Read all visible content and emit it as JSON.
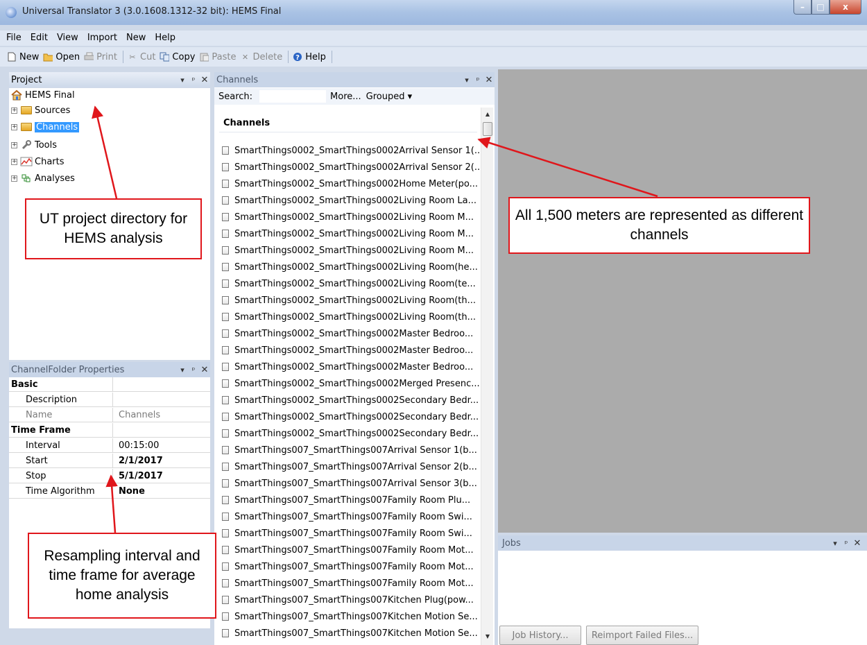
{
  "window": {
    "title": "Universal Translator 3 (3.0.1608.1312-32 bit): HEMS Final",
    "controls": {
      "minimize": "–",
      "maximize": "□",
      "close": "x"
    }
  },
  "menubar": [
    "File",
    "Edit",
    "View",
    "Import",
    "New",
    "Help"
  ],
  "toolbar": {
    "new": "New",
    "open": "Open",
    "print": "Print",
    "cut": "Cut",
    "copy": "Copy",
    "paste": "Paste",
    "delete": "Delete",
    "help": "Help"
  },
  "panel_controls": {
    "dropdown": "▾",
    "pin": "ᵖ",
    "close": "✕"
  },
  "project": {
    "header": "Project",
    "root": "HEMS Final",
    "expander": "+",
    "items": [
      {
        "label": "Sources",
        "icon": "folder-icon"
      },
      {
        "label": "Channels",
        "icon": "folder-icon",
        "selected": true
      },
      {
        "label": "Tools",
        "icon": "wrench-icon"
      },
      {
        "label": "Charts",
        "icon": "chart-icon"
      },
      {
        "label": "Analyses",
        "icon": "analysis-icon"
      }
    ]
  },
  "properties": {
    "header": "ChannelFolder Properties",
    "rows": [
      {
        "key": "Basic",
        "value": ""
      },
      {
        "key": "Description",
        "value": ""
      },
      {
        "key": "Name",
        "value": "Channels"
      },
      {
        "key": "Time Frame",
        "value": ""
      },
      {
        "key": "Interval",
        "value": "00:15:00"
      },
      {
        "key": "Start",
        "value": "2/1/2017"
      },
      {
        "key": "Stop",
        "value": "5/1/2017"
      },
      {
        "key": "Time Algorithm",
        "value": "None"
      }
    ]
  },
  "channels": {
    "header": "Channels",
    "search_label": "Search:",
    "search_value": "",
    "more": "More...",
    "grouped": "Grouped ▾",
    "group_title": "Channels",
    "items": [
      "SmartThings0002_SmartThings0002Arrival Sensor 1(...",
      "SmartThings0002_SmartThings0002Arrival Sensor 2(...",
      "SmartThings0002_SmartThings0002Home Meter(po...",
      "SmartThings0002_SmartThings0002Living Room La...",
      "SmartThings0002_SmartThings0002Living Room M...",
      "SmartThings0002_SmartThings0002Living Room M...",
      "SmartThings0002_SmartThings0002Living Room M...",
      "SmartThings0002_SmartThings0002Living Room(he...",
      "SmartThings0002_SmartThings0002Living Room(te...",
      "SmartThings0002_SmartThings0002Living Room(th...",
      "SmartThings0002_SmartThings0002Living Room(th...",
      "SmartThings0002_SmartThings0002Master Bedroo...",
      "SmartThings0002_SmartThings0002Master Bedroo...",
      "SmartThings0002_SmartThings0002Master Bedroo...",
      "SmartThings0002_SmartThings0002Merged Presenc...",
      "SmartThings0002_SmartThings0002Secondary Bedr...",
      "SmartThings0002_SmartThings0002Secondary Bedr...",
      "SmartThings0002_SmartThings0002Secondary Bedr...",
      "SmartThings007_SmartThings007Arrival Sensor 1(b...",
      "SmartThings007_SmartThings007Arrival Sensor 2(b...",
      "SmartThings007_SmartThings007Arrival Sensor 3(b...",
      "SmartThings007_SmartThings007Family Room Plu...",
      "SmartThings007_SmartThings007Family Room Swi...",
      "SmartThings007_SmartThings007Family Room Swi...",
      "SmartThings007_SmartThings007Family Room Mot...",
      "SmartThings007_SmartThings007Family Room Mot...",
      "SmartThings007_SmartThings007Family Room Mot...",
      "SmartThings007_SmartThings007Kitchen Plug(pow...",
      "SmartThings007_SmartThings007Kitchen Motion Se...",
      "SmartThings007_SmartThings007Kitchen Motion Se..."
    ],
    "scroll_up": "▲",
    "scroll_down": "▼"
  },
  "jobs": {
    "header": "Jobs",
    "job_history": "Job History...",
    "reimport": "Reimport Failed Files..."
  },
  "annotations": {
    "project_dir": "UT project directory for HEMS analysis",
    "meters": "All 1,500 meters are represented as different channels",
    "resampling": "Resampling interval and time frame for average home analysis"
  },
  "colors": {
    "callout_border": "#e0161b",
    "selection": "#3399ff",
    "workspace": "#ababab"
  }
}
